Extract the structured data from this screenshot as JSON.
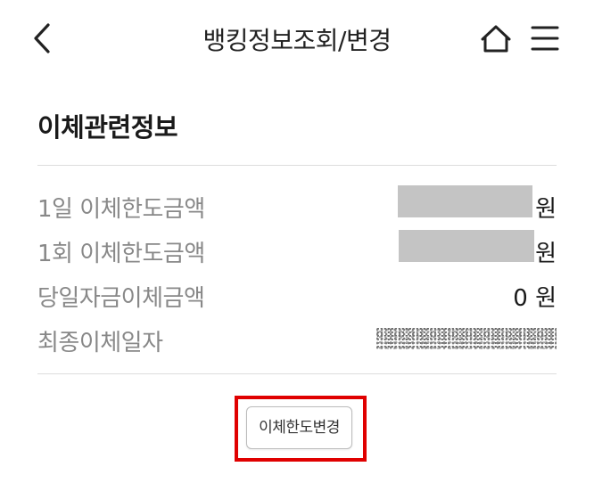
{
  "header": {
    "title": "뱅킹정보조회/변경",
    "back_icon": "chevron-left-icon",
    "home_icon": "home-icon",
    "menu_icon": "hamburger-menu-icon"
  },
  "section": {
    "title": "이체관련정보",
    "rows": [
      {
        "label": "1일 이체한도금액",
        "value": "",
        "unit": "원",
        "masked": true
      },
      {
        "label": "1회 이체한도금액",
        "value": "",
        "unit": "원",
        "masked": true
      },
      {
        "label": "당일자금이체금액",
        "value": "0 원"
      },
      {
        "label": "최종이체일자",
        "value": "",
        "masked": true
      }
    ]
  },
  "actions": {
    "change_limit_label": "이체한도변경",
    "highlight_color": "#e00000"
  }
}
